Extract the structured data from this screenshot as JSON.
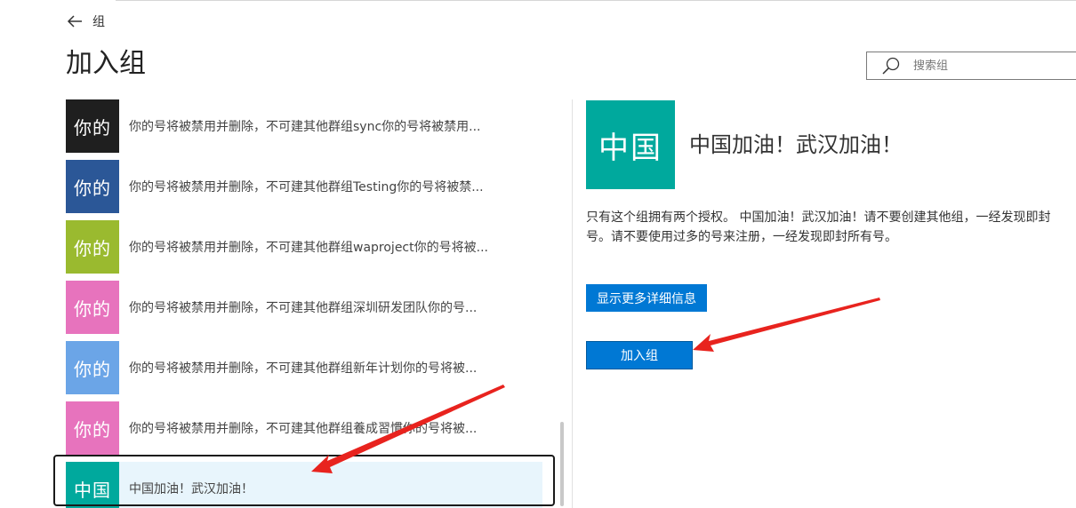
{
  "header": {
    "back_label": "组",
    "title": "加入组"
  },
  "search": {
    "placeholder": "搜索组"
  },
  "groups": [
    {
      "avatar_text": "你的",
      "avatar_color": "#1f1f1f",
      "text": "你的号将被禁用并删除，不可建其他群组sync你的号将被禁用..."
    },
    {
      "avatar_text": "你的",
      "avatar_color": "#2b5797",
      "text": "你的号将被禁用并删除，不可建其他群组Testing你的号将被禁..."
    },
    {
      "avatar_text": "你的",
      "avatar_color": "#9aba2f",
      "text": "你的号将被禁用并删除，不可建其他群组waproject你的号将被..."
    },
    {
      "avatar_text": "你的",
      "avatar_color": "#e773bd",
      "text": "你的号将被禁用并删除，不可建其他群组深圳研发团队你的号..."
    },
    {
      "avatar_text": "你的",
      "avatar_color": "#6ba5e7",
      "text": "你的号将被禁用并删除，不可建其他群组新年计划你的号将被..."
    },
    {
      "avatar_text": "你的",
      "avatar_color": "#e773bd",
      "text": "你的号将被禁用并删除，不可建其他群组養成習慣你的号将被..."
    },
    {
      "avatar_text": "中国",
      "avatar_color": "#00a99d",
      "text": "中国加油！武汉加油！",
      "selected": true
    }
  ],
  "detail": {
    "avatar_text": "中国",
    "avatar_color": "#00a99d",
    "name": "中国加油！武汉加油！",
    "description": "只有这个组拥有两个授权。 中国加油！武汉加油！请不要创建其他组，一经发现即封号。请不要使用过多的号来注册，一经发现即封所有号。",
    "more_button": "显示更多详细信息",
    "join_button": "加入组"
  },
  "colors": {
    "accent": "#0078d4",
    "annotation_arrow": "#e8231e",
    "selected_bg": "#e8f5fc"
  }
}
